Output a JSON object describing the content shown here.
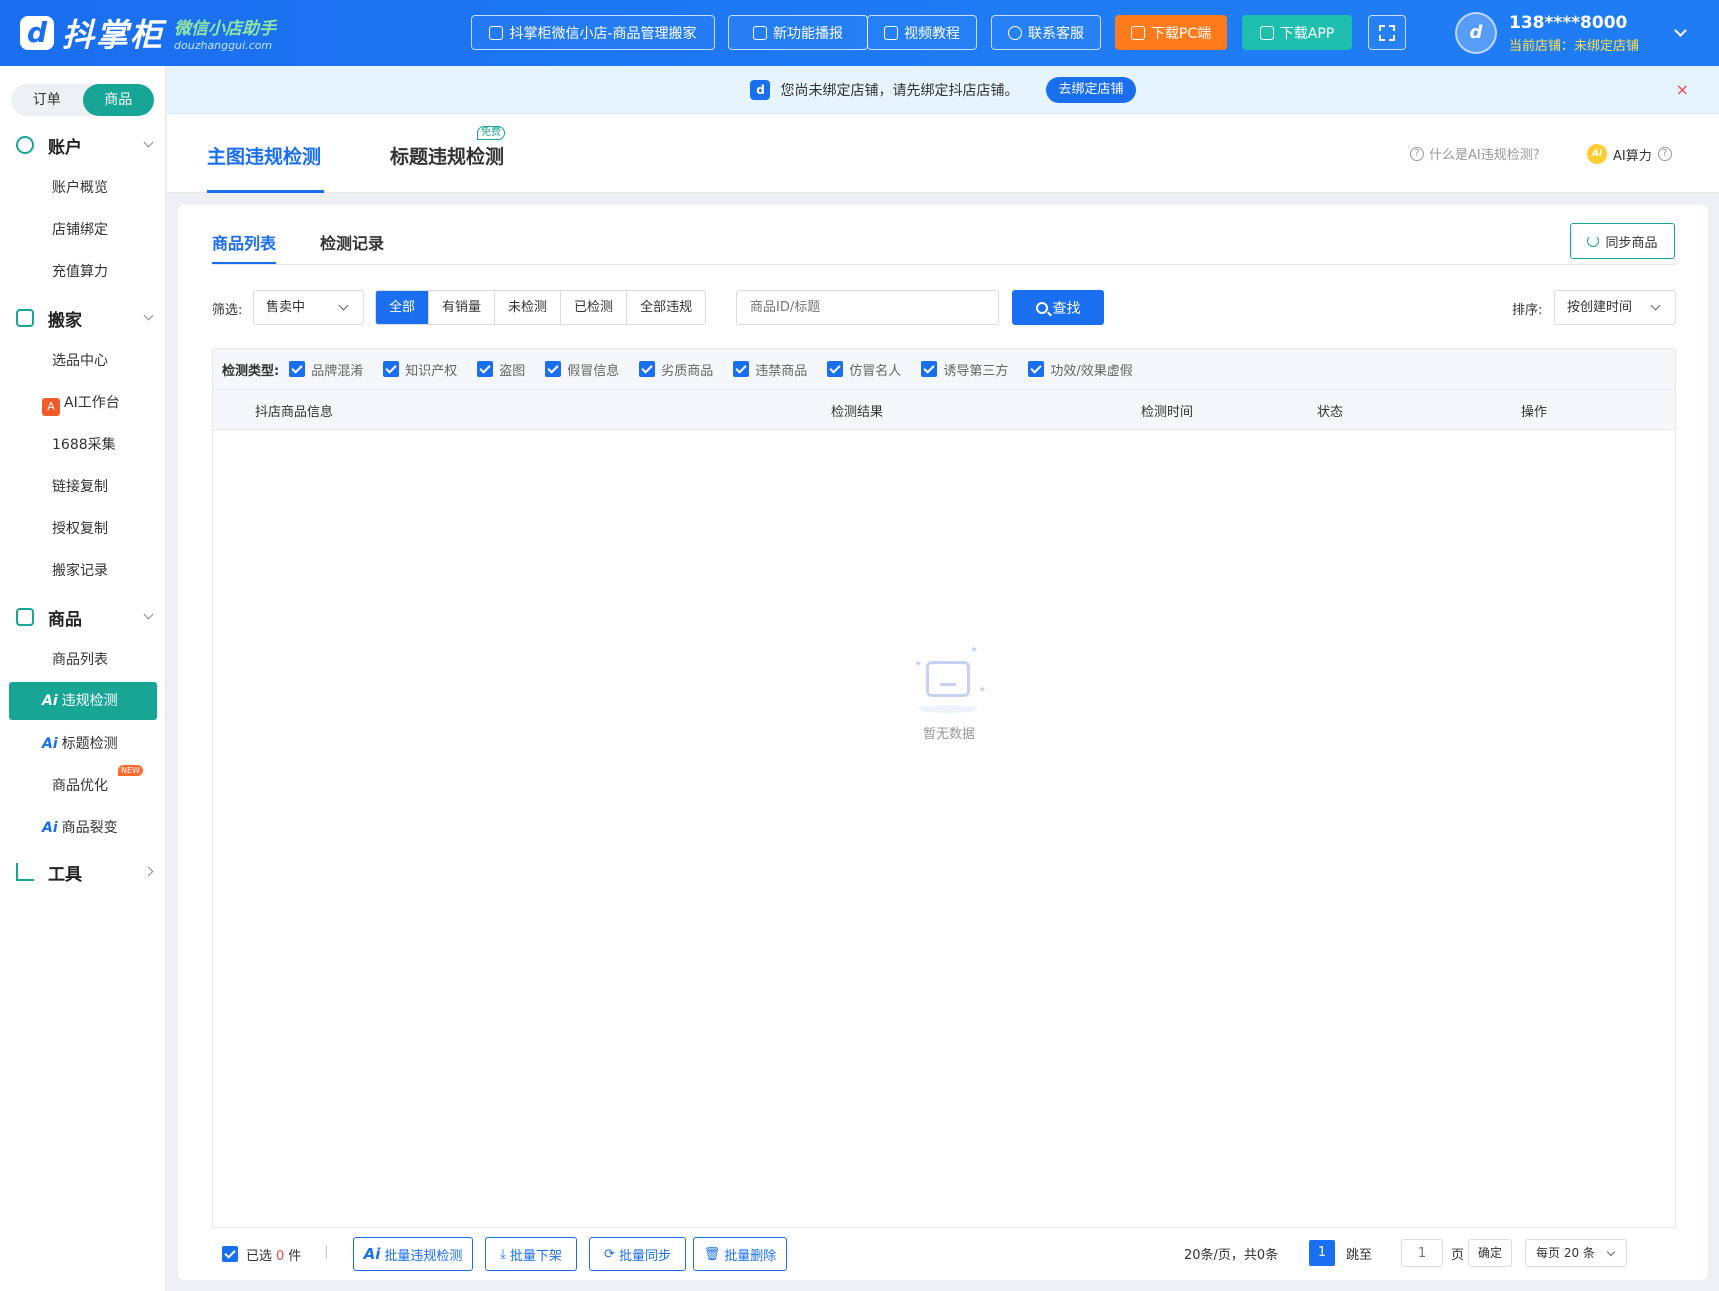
{
  "header": {
    "logo_mark": "d",
    "logo_title": "抖掌柜",
    "logo_sub": "微信小店助手",
    "logo_domain": "douzhanggui.com",
    "buttons": [
      {
        "label": "抖掌柜微信小店-商品管理搬家",
        "icon": "shop-icon"
      },
      {
        "label": "新功能播报",
        "icon": "megaphone-icon"
      },
      {
        "label": "视频教程",
        "icon": "video-icon"
      },
      {
        "label": "联系客服",
        "icon": "headset-icon"
      },
      {
        "label": "下载PC端",
        "icon": "download-icon",
        "color": "#ff7a1a"
      },
      {
        "label": "下载APP",
        "icon": "download-icon",
        "color": "#1fbfb0"
      }
    ],
    "fullscreen_icon": "fullscreen-icon",
    "user": {
      "avatar": "d",
      "phone": "138****8000",
      "shop_label": "当前店铺：未绑定店铺"
    }
  },
  "sidebar": {
    "segment": [
      "订单",
      "商品"
    ],
    "segment_active": "商品",
    "groups": [
      {
        "label": "账户",
        "icon": "smile-icon",
        "items": [
          "账户概览",
          "店铺绑定",
          "充值算力"
        ]
      },
      {
        "label": "搬家",
        "icon": "inbox-icon",
        "items": [
          "选品中心",
          "AI工作台",
          "1688采集",
          "链接复制",
          "授权复制",
          "搬家记录"
        ]
      },
      {
        "label": "商品",
        "icon": "bag-icon",
        "items": [
          "商品列表",
          "违规检测",
          "标题检测",
          "商品优化",
          "商品裂变"
        ]
      },
      {
        "label": "工具",
        "icon": "chart-line-icon",
        "items": []
      }
    ],
    "ai_prefix": "Ai",
    "a_badge": "A",
    "new_tag": "NEW",
    "active_item": "违规检测"
  },
  "notice": {
    "text": "您尚未绑定店铺，请先绑定抖店店铺。",
    "button": "去绑定店铺",
    "close": "×"
  },
  "page_tabs": {
    "tabs": [
      "主图违规检测",
      "标题违规检测"
    ],
    "active": "主图违规检测",
    "free_tag": "免费",
    "help_link": "什么是AI违规检测?",
    "ai_power": "AI算力",
    "coin": "Ai",
    "q": "?"
  },
  "content": {
    "sub_tabs": [
      "商品列表",
      "检测记录"
    ],
    "sync_button": "同步商品",
    "filter_label": "筛选:",
    "filter_select": "售卖中",
    "filter_buttons": [
      "全部",
      "有销量",
      "未检测",
      "已检测",
      "全部违规"
    ],
    "filter_active": "全部",
    "search_placeholder": "商品ID/标题",
    "search_button": "查找",
    "sort_label": "排序:",
    "sort_select": "按创建时间",
    "detect_type_label": "检测类型:",
    "detect_types": [
      "品牌混淆",
      "知识产权",
      "盗图",
      "假冒信息",
      "劣质商品",
      "违禁商品",
      "仿冒名人",
      "诱导第三方",
      "功效/效果虚假"
    ],
    "columns": [
      "抖店商品信息",
      "检测结果",
      "检测时间",
      "状态",
      "操作"
    ],
    "empty_text": "暂无数据"
  },
  "bottom": {
    "selected_prefix": "已选",
    "selected_count": "0",
    "selected_suffix": "件",
    "separator": "|",
    "actions": [
      {
        "label": "批量违规检测",
        "icon": "ai-icon"
      },
      {
        "label": "批量下架",
        "icon": "download-icon"
      },
      {
        "label": "批量同步",
        "icon": "refresh-icon"
      },
      {
        "label": "批量删除",
        "icon": "trash-icon"
      }
    ],
    "pagination": {
      "summary": "20条/页，共0条",
      "current_page": "1",
      "jump_label": "跳至",
      "jump_value": "1",
      "page_unit": "页",
      "confirm": "确定",
      "page_size": "每页 20 条"
    }
  }
}
